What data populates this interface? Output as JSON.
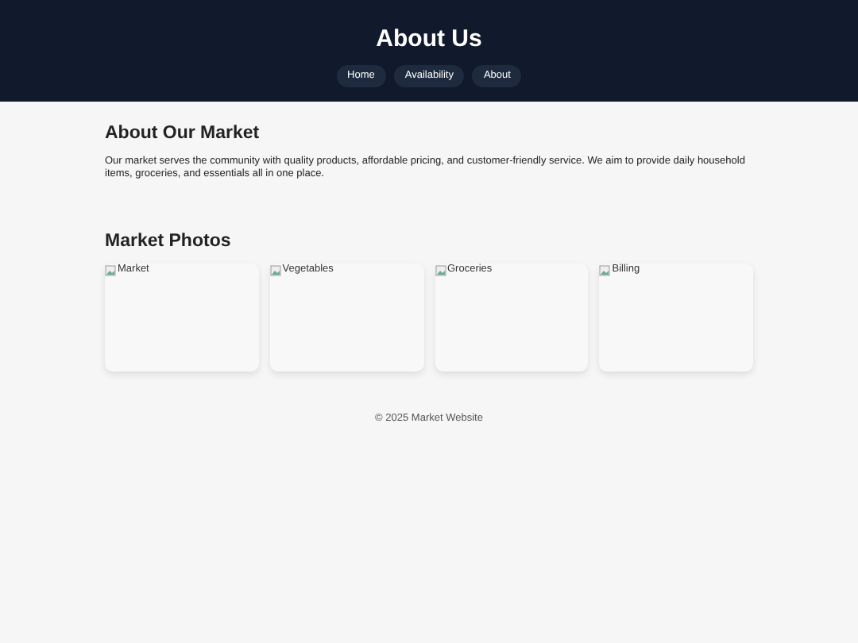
{
  "header": {
    "title": "About Us",
    "nav": [
      {
        "label": "Home"
      },
      {
        "label": "Availability"
      },
      {
        "label": "About"
      }
    ]
  },
  "about": {
    "heading": "About Our Market",
    "text": "Our market serves the community with quality products, affordable pricing, and customer-friendly service. We aim to provide daily household items, groceries, and essentials all in one place."
  },
  "photos": {
    "heading": "Market Photos",
    "items": [
      {
        "alt": "Market"
      },
      {
        "alt": "Vegetables"
      },
      {
        "alt": "Groceries"
      },
      {
        "alt": "Billing"
      }
    ]
  },
  "footer": {
    "text": "© 2025 Market Website"
  }
}
